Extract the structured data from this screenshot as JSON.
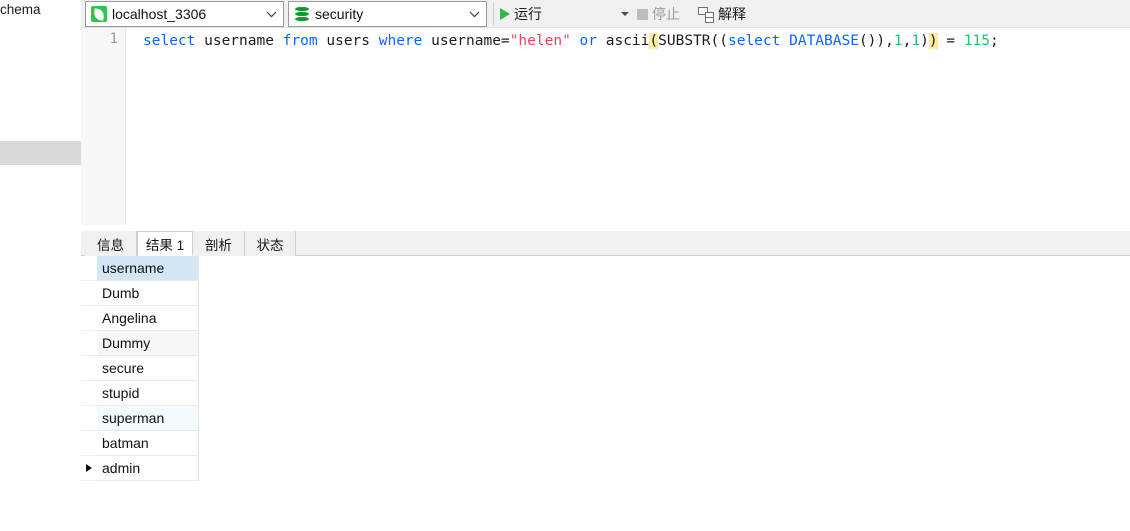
{
  "left_panel": {
    "truncated_label": "chema",
    "selected_band": true
  },
  "toolbar": {
    "connection": {
      "value": "localhost_3306",
      "icon": "connection-leaf-icon",
      "arrow_icon": "chevron-down-icon"
    },
    "database": {
      "value": "security",
      "icon": "database-icon",
      "arrow_icon": "chevron-down-icon"
    },
    "run_label": "运行",
    "run_icon": "play-icon",
    "run_dropdown_icon": "caret-down-icon",
    "stop_label": "停止",
    "stop_icon": "stop-square-icon",
    "stop_disabled": true,
    "explain_label": "解释",
    "explain_icon": "explain-plan-icon"
  },
  "editor": {
    "line_number": "1",
    "tokens": [
      {
        "text": "select",
        "type": "kw"
      },
      {
        "text": " username ",
        "type": "plain"
      },
      {
        "text": "from",
        "type": "kw"
      },
      {
        "text": " users ",
        "type": "plain"
      },
      {
        "text": "where",
        "type": "kw"
      },
      {
        "text": " username=",
        "type": "plain"
      },
      {
        "text": "\"helen\"",
        "type": "str"
      },
      {
        "text": " ",
        "type": "plain"
      },
      {
        "text": "or",
        "type": "kw"
      },
      {
        "text": " ascii",
        "type": "plain"
      },
      {
        "text": "(",
        "type": "brmatch"
      },
      {
        "text": "SUBSTR((",
        "type": "plain"
      },
      {
        "text": "select",
        "type": "kw"
      },
      {
        "text": " ",
        "type": "plain"
      },
      {
        "text": "DATABASE",
        "type": "kw"
      },
      {
        "text": "()),",
        "type": "plain"
      },
      {
        "text": "1",
        "type": "num"
      },
      {
        "text": ",",
        "type": "plain"
      },
      {
        "text": "1",
        "type": "num"
      },
      {
        "text": ")",
        "type": "plain"
      },
      {
        "text": ")",
        "type": "brmatch"
      },
      {
        "text": " = ",
        "type": "plain"
      },
      {
        "text": "115",
        "type": "num"
      },
      {
        "text": ";",
        "type": "plain"
      }
    ],
    "full_text": "select username from users where username=\"helen\" or ascii(SUBSTR((select DATABASE()),1,1)) = 115;"
  },
  "result": {
    "tabs": [
      {
        "label": "信息",
        "active": false
      },
      {
        "label": "结果 1",
        "active": true
      },
      {
        "label": "剖析",
        "active": false
      },
      {
        "label": "状态",
        "active": false
      }
    ],
    "grid": {
      "columns": [
        "username"
      ],
      "rows": [
        {
          "username": "Dumb",
          "style": "plainbg",
          "current": false
        },
        {
          "username": "Angelina",
          "style": "plainbg",
          "current": false
        },
        {
          "username": "Dummy",
          "style": "alt",
          "current": false
        },
        {
          "username": "secure",
          "style": "plainbg",
          "current": false
        },
        {
          "username": "stupid",
          "style": "plainbg",
          "current": false
        },
        {
          "username": "superman",
          "style": "alt2",
          "current": false
        },
        {
          "username": "batman",
          "style": "plainbg",
          "current": false
        },
        {
          "username": "admin",
          "style": "plainbg",
          "current": true
        }
      ]
    }
  },
  "colors": {
    "toolbar_bg": "#f0f0f0",
    "editor_bg": "#ffffff",
    "keyword": "#0b66ff",
    "string": "#e8415e",
    "number": "#1ec46a",
    "bracket_match_bg": "#ffe9a0",
    "header_cell_bg": "#d2e6f5",
    "run_green": "#3bb54a",
    "db_green": "#0f9a2e"
  }
}
